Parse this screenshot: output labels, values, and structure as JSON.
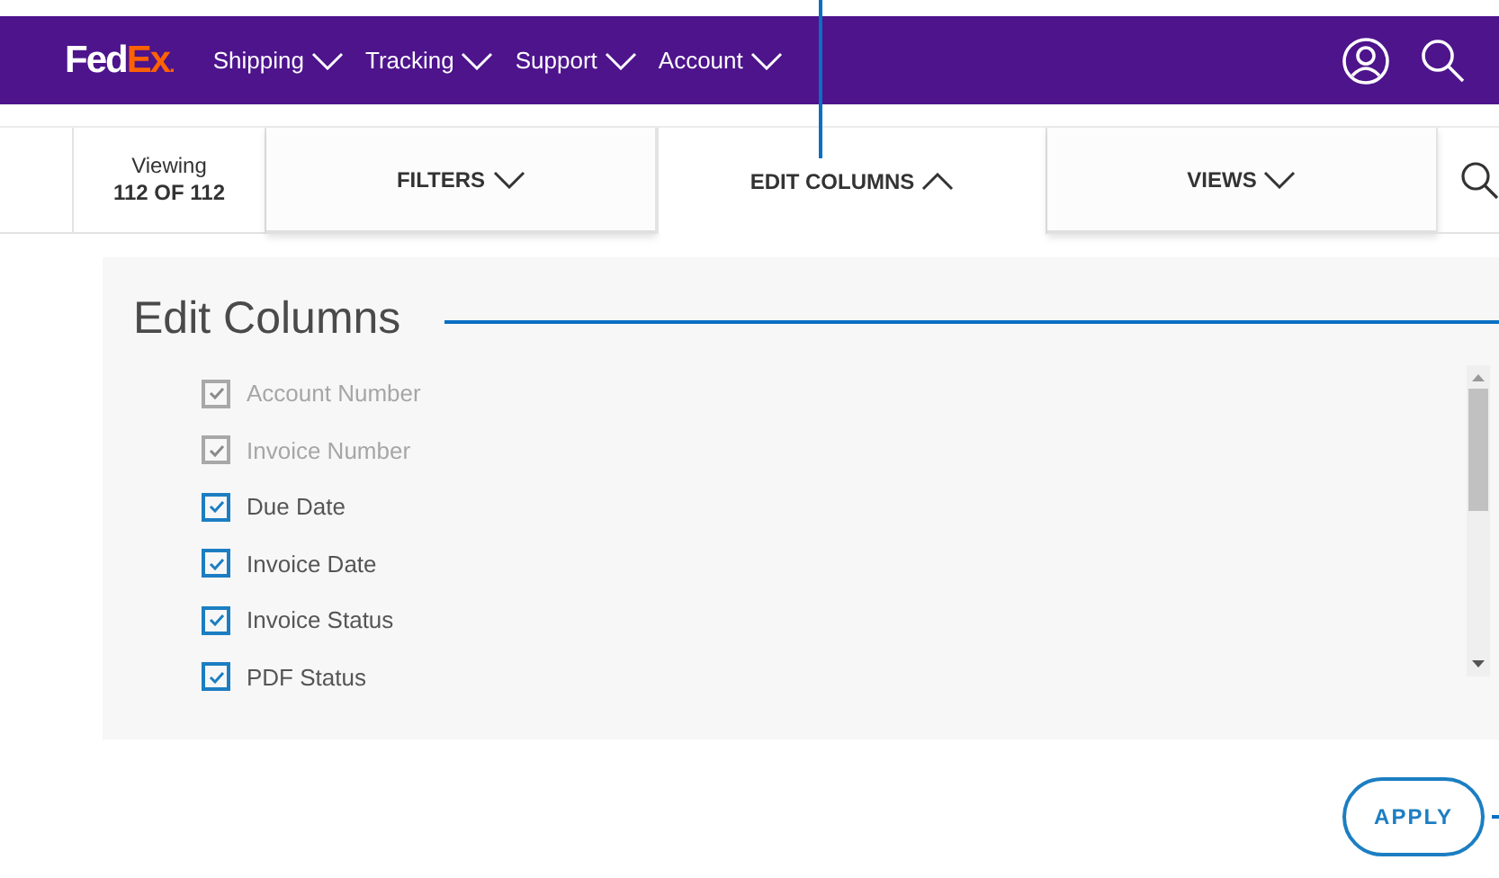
{
  "nav": {
    "logo_left": "Fed",
    "logo_right": "Ex",
    "logo_dot": ".",
    "menus": [
      {
        "label": "Shipping"
      },
      {
        "label": "Tracking"
      },
      {
        "label": "Support"
      },
      {
        "label": "Account"
      }
    ]
  },
  "toolbar": {
    "viewing_label": "Viewing",
    "viewing_count": "112 OF 112",
    "tabs": [
      {
        "label": "FILTERS",
        "selected": false
      },
      {
        "label": "EDIT COLUMNS",
        "selected": true
      },
      {
        "label": "VIEWS",
        "selected": false
      }
    ]
  },
  "panel": {
    "title": "Edit Columns",
    "columns": [
      {
        "label": "Account Number",
        "checked": true,
        "disabled": true
      },
      {
        "label": "Invoice Number",
        "checked": true,
        "disabled": true
      },
      {
        "label": "Due Date",
        "checked": true,
        "disabled": false
      },
      {
        "label": "Invoice Date",
        "checked": true,
        "disabled": false
      },
      {
        "label": "Invoice Status",
        "checked": true,
        "disabled": false
      },
      {
        "label": "PDF Status",
        "checked": true,
        "disabled": false
      }
    ],
    "apply_button": "APPLY"
  }
}
